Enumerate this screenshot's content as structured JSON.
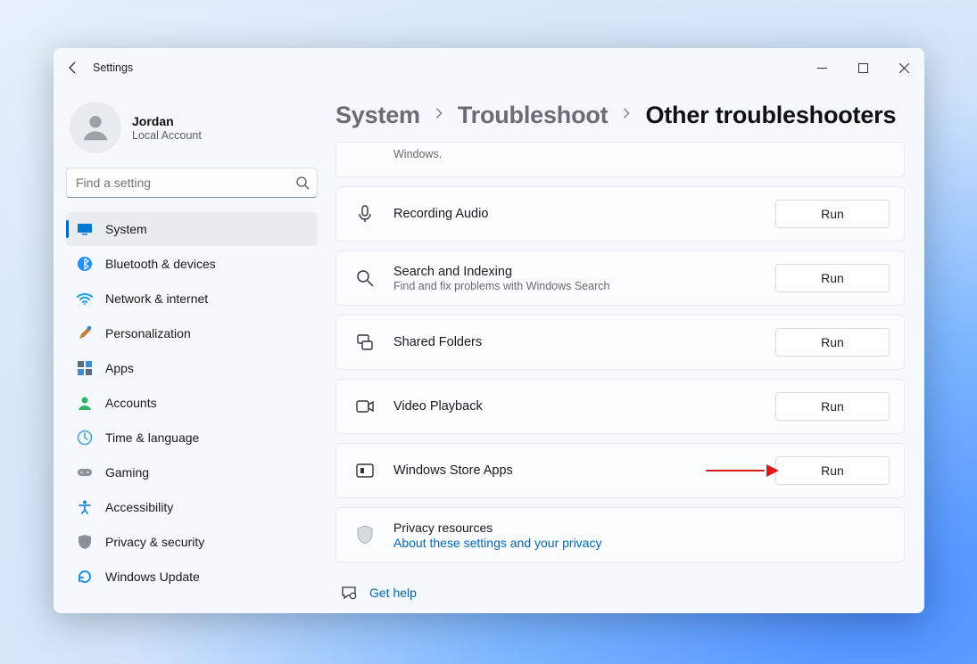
{
  "titlebar": {
    "title": "Settings"
  },
  "account": {
    "name": "Jordan",
    "type": "Local Account"
  },
  "search": {
    "placeholder": "Find a setting"
  },
  "sidebar": {
    "items": [
      {
        "key": "system",
        "label": "System",
        "active": true
      },
      {
        "key": "bluetooth",
        "label": "Bluetooth & devices"
      },
      {
        "key": "network",
        "label": "Network & internet"
      },
      {
        "key": "personalization",
        "label": "Personalization"
      },
      {
        "key": "apps",
        "label": "Apps"
      },
      {
        "key": "accounts",
        "label": "Accounts"
      },
      {
        "key": "time",
        "label": "Time & language"
      },
      {
        "key": "gaming",
        "label": "Gaming"
      },
      {
        "key": "accessibility",
        "label": "Accessibility"
      },
      {
        "key": "privacy",
        "label": "Privacy & security"
      },
      {
        "key": "update",
        "label": "Windows Update"
      }
    ]
  },
  "breadcrumb": {
    "crumb0": "System",
    "crumb1": "Troubleshoot",
    "crumb2": "Other troubleshooters"
  },
  "cards": {
    "partial_desc": "Windows.",
    "recording_audio": "Recording Audio",
    "search_indexing": "Search and Indexing",
    "search_indexing_desc": "Find and fix problems with Windows Search",
    "shared_folders": "Shared Folders",
    "video_playback": "Video Playback",
    "store_apps": "Windows Store Apps",
    "run": "Run"
  },
  "privacy": {
    "title": "Privacy resources",
    "link": "About these settings and your privacy"
  },
  "footer": {
    "help": "Get help"
  }
}
